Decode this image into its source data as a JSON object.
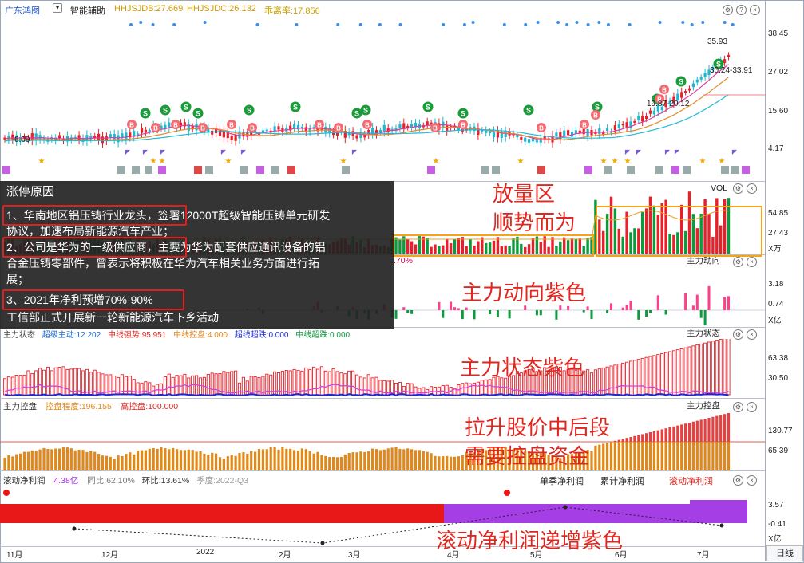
{
  "header": {
    "title": "广东鸿图",
    "assist": "智能辅助",
    "indicator1": "HHJSJDB:27.669",
    "indicator2": "HHJSJDC:26.132",
    "indicator3": "乖离率:17.856"
  },
  "price_panel": {
    "y_ticks": [
      "38.45",
      "27.02",
      "15.60",
      "4.17"
    ],
    "labels": [
      "35.93",
      "30.24-33.91",
      "19.87-20.12",
      "6.09"
    ]
  },
  "vol_panel": {
    "name": "VOL",
    "y_ticks": [
      "54.85",
      "27.43"
    ],
    "unit": "X万",
    "partial_label": ".70%"
  },
  "main_dir_panel": {
    "name": "主力动向",
    "y_ticks": [
      "3.18",
      "0.74"
    ],
    "unit": "X亿"
  },
  "main_state_panel": {
    "name": "主力状态",
    "legend": [
      "超级主动:12.202",
      "中线强势:95.951",
      "中线控盘:4.000",
      "超线超跌:0.000",
      "中线超跌:0.000"
    ],
    "y_ticks": [
      "63.38",
      "30.50"
    ]
  },
  "control_panel": {
    "title": "主力控盘",
    "legend1": "控盘程度:196.155",
    "legend2": "高控盘:100.000",
    "name": "主力控盘",
    "y_ticks": [
      "130.77",
      "65.39"
    ]
  },
  "profit_panel": {
    "title": "滚动净利润",
    "value": "4.38亿",
    "yoy": "同比:62.10%",
    "qoq": "环比:13.61%",
    "season": "季度:2022-Q3",
    "tabs": [
      "单季净利润",
      "累计净利润",
      "滚动净利润"
    ],
    "y_ticks": [
      "3.57",
      "-0.41"
    ],
    "unit": "X亿"
  },
  "x_axis": [
    "11月",
    "12月",
    "2022",
    "2月",
    "3月",
    "4月",
    "5月",
    "6月",
    "7月"
  ],
  "day_tab": "日线",
  "overlay": {
    "title": "涨停原因",
    "lines": [
      "1、华南地区铝压铸行业龙头，签署12000T超级智能压铸单元研发",
      "协议，加速布局新能源汽车产业；",
      "2、公司是华为的一级供应商，主要为华为配套供应通讯设备的铝",
      "合金压铸零部件，曾表示将积极在华为汽车相关业务方面进行拓",
      "展；",
      "3、2021年净利预增70%-90%",
      "工信部正式开展新一轮新能源汽车下乡活动"
    ]
  },
  "annotations": {
    "vol": "放量区",
    "vol2": "顺势而为",
    "main_dir": "主力动向紫色",
    "main_state": "主力状态紫色",
    "control1": "拉升股价中后段",
    "control2": "需要控盘资金",
    "profit": "滚动净利润递增紫色"
  },
  "markers": {
    "buy": "B",
    "sell": "S"
  },
  "colors": {
    "up": "#e8202a",
    "down": "#0b9a3c",
    "purple": "#a033e6",
    "orange": "#e0881a",
    "annotation": "#e0261f",
    "header_yellow": "#c8a000"
  }
}
